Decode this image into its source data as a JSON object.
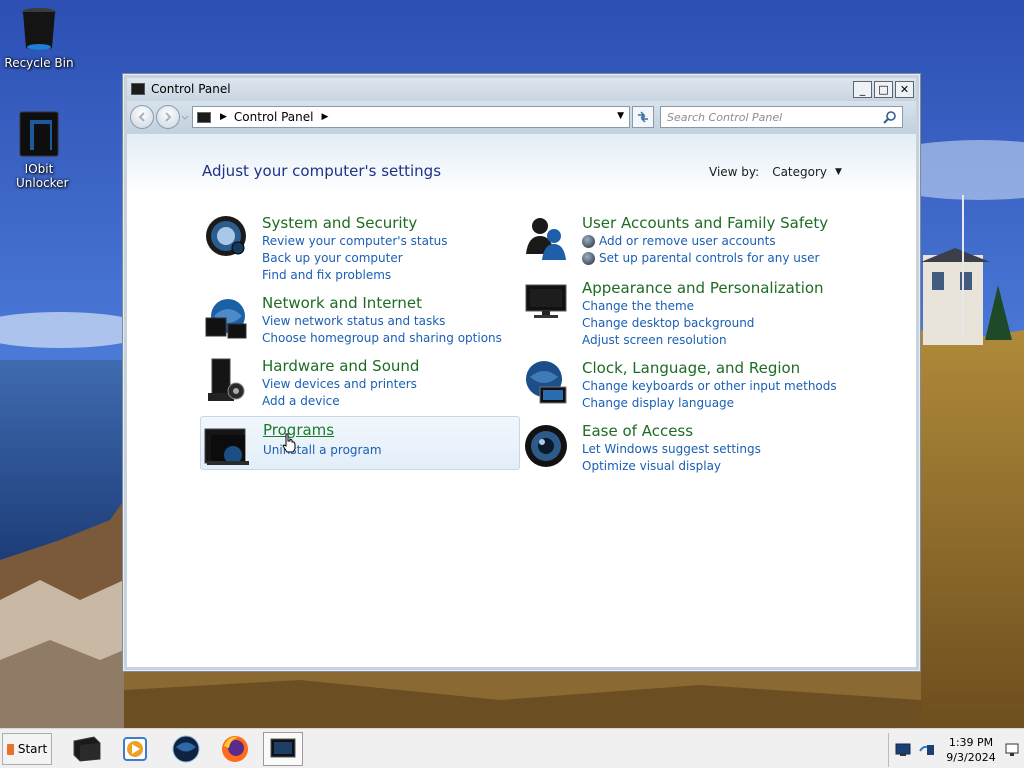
{
  "desktop": {
    "icons": [
      {
        "label": "Recycle Bin",
        "icon": "recycle-bin-icon"
      },
      {
        "label": "IObit Unlocker",
        "icon": "iobit-unlocker-icon"
      }
    ]
  },
  "window": {
    "title": "Control Panel",
    "buttons": {
      "minimize": "_",
      "maximize": "□",
      "close": "✕"
    },
    "address": {
      "crumb": "Control Panel"
    },
    "search": {
      "placeholder": "Search Control Panel"
    },
    "heading": "Adjust your computer's settings",
    "view_by": {
      "label": "View by:",
      "value": "Category"
    },
    "categories": [
      {
        "title": "System and Security",
        "links": [
          "Review your computer's status",
          "Back up your computer",
          "Find and fix problems"
        ],
        "icon": "system-security-icon"
      },
      {
        "title": "Network and Internet",
        "links": [
          "View network status and tasks",
          "Choose homegroup and sharing options"
        ],
        "icon": "network-icon"
      },
      {
        "title": "Hardware and Sound",
        "links": [
          "View devices and printers",
          "Add a device"
        ],
        "icon": "hardware-sound-icon"
      },
      {
        "title": "Programs",
        "links": [
          "Uninstall a program"
        ],
        "icon": "programs-icon"
      },
      {
        "title": "User Accounts and Family Safety",
        "links": [
          "Add or remove user accounts",
          "Set up parental controls for any user"
        ],
        "icon": "user-accounts-icon"
      },
      {
        "title": "Appearance and Personalization",
        "links": [
          "Change the theme",
          "Change desktop background",
          "Adjust screen resolution"
        ],
        "icon": "appearance-icon"
      },
      {
        "title": "Clock, Language, and Region",
        "links": [
          "Change keyboards or other input methods",
          "Change display language"
        ],
        "icon": "clock-region-icon"
      },
      {
        "title": "Ease of Access",
        "links": [
          "Let Windows suggest settings",
          "Optimize visual display"
        ],
        "icon": "ease-of-access-icon"
      }
    ]
  },
  "taskbar": {
    "start_label": "Start",
    "apps": [
      "file-explorer-icon",
      "media-player-icon",
      "globe-icon",
      "firefox-icon",
      "control-panel-icon"
    ],
    "clock": {
      "time": "1:39 PM",
      "date": "9/3/2024"
    }
  },
  "colors": {
    "category_title": "#1e6b26",
    "link": "#1a5fb4",
    "heading": "#1e3287"
  }
}
